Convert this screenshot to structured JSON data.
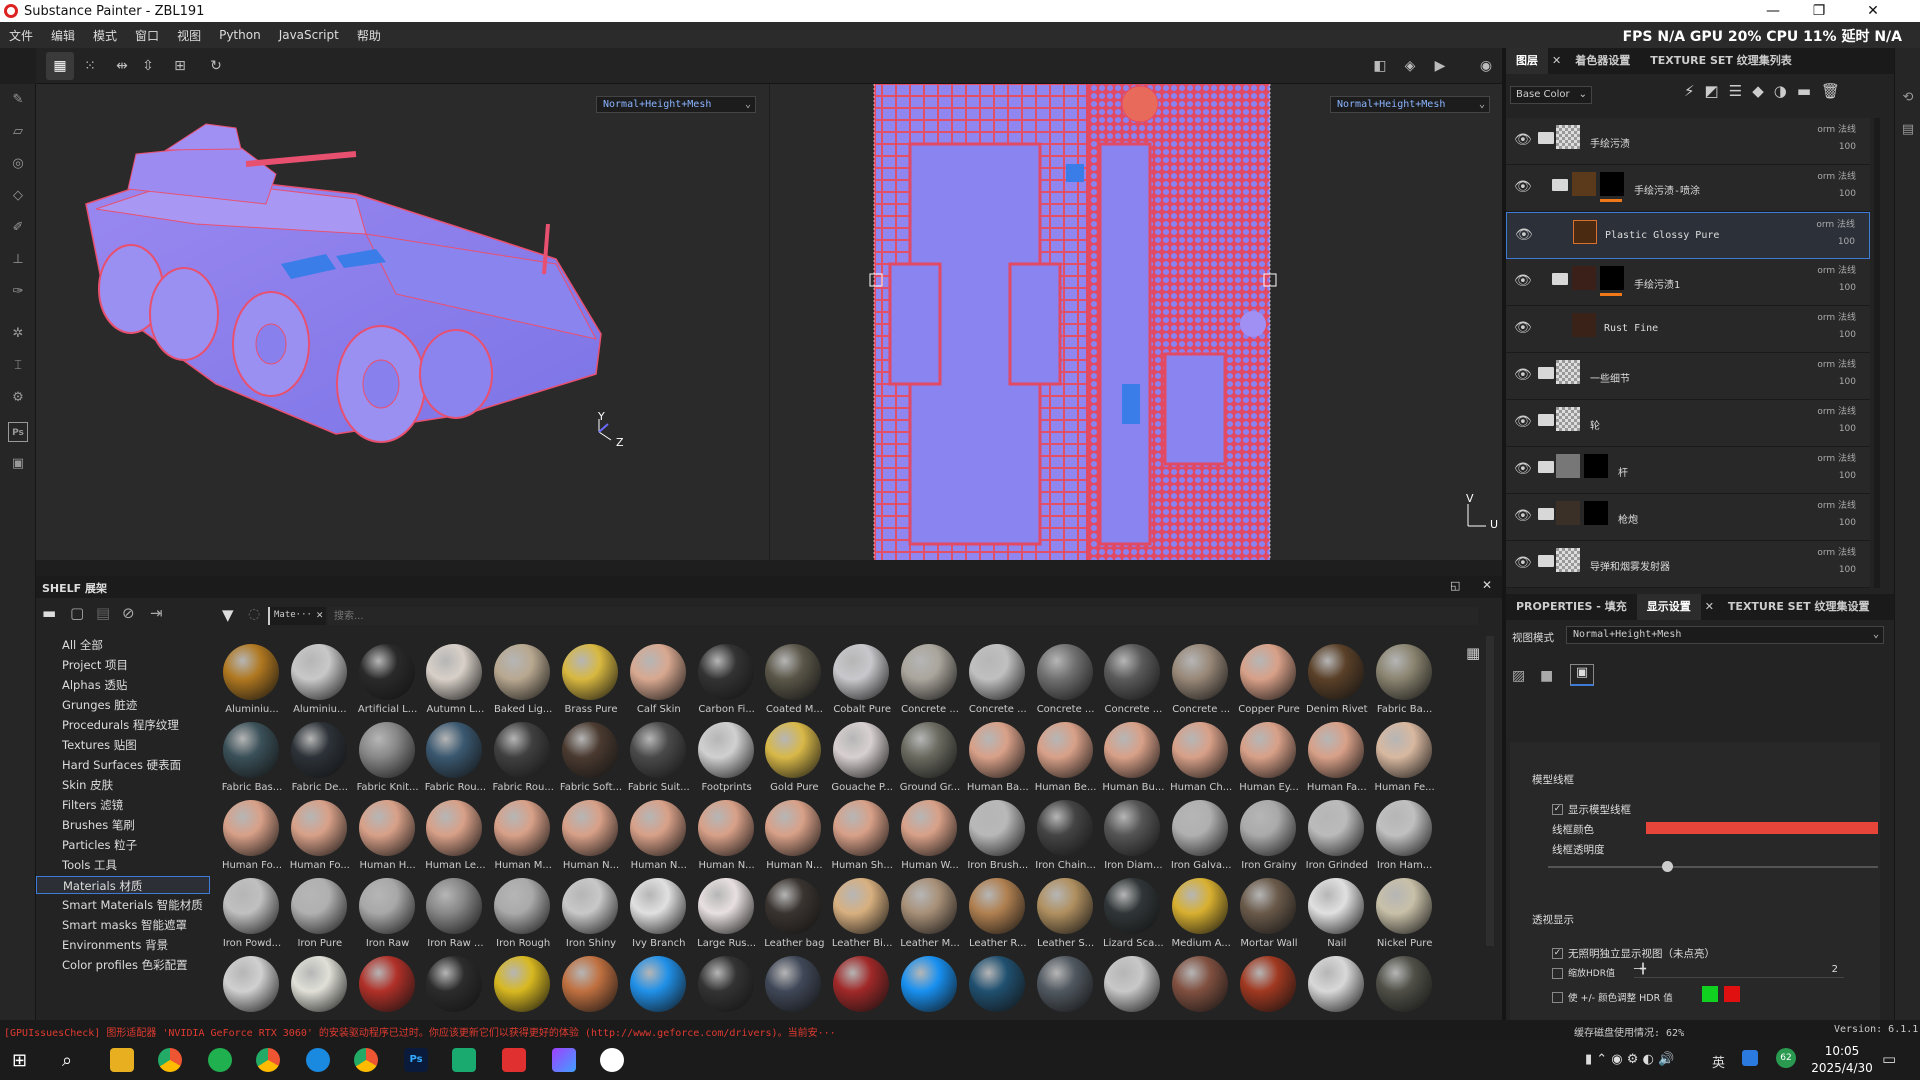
{
  "window": {
    "title": "Substance Painter - ZBL191",
    "minimize": "—",
    "restore": "❐",
    "close": "✕"
  },
  "menu": [
    "文件",
    "编辑",
    "模式",
    "窗口",
    "视图",
    "Python",
    "JavaScript",
    "帮助"
  ],
  "stats": "FPS N/A GPU 20% CPU 11% 延时 N/A",
  "viewport": {
    "mode_3d": "Normal+Height+Mesh",
    "mode_2d": "Normal+Height+Mesh",
    "axis_3d": {
      "y": "Y",
      "z": "Z"
    },
    "axis_2d": {
      "v": "V",
      "u": "U"
    }
  },
  "layers_panel": {
    "tabs": [
      "图层",
      "着色器设置",
      "TEXTURE SET 纹理集列表"
    ],
    "channel": "Base Color",
    "layers": [
      {
        "name": "手绘污渍",
        "blend": "orm 法线",
        "opacity": "100",
        "type": "folder"
      },
      {
        "name": "手绘污渍-喷涂",
        "blend": "orm 法线",
        "opacity": "100",
        "type": "folder-mask"
      },
      {
        "name": "Plastic Glossy Pure",
        "blend": "orm 法线",
        "opacity": "100",
        "type": "fill",
        "selected": true
      },
      {
        "name": "手绘污渍1",
        "blend": "orm 法线",
        "opacity": "100",
        "type": "folder-mask"
      },
      {
        "name": "Rust Fine",
        "blend": "orm 法线",
        "opacity": "100",
        "type": "fill"
      },
      {
        "name": "一些细节",
        "blend": "orm 法线",
        "opacity": "100",
        "type": "folder"
      },
      {
        "name": "轮",
        "blend": "orm 法线",
        "opacity": "100",
        "type": "folder"
      },
      {
        "name": "杆",
        "blend": "orm 法线",
        "opacity": "100",
        "type": "folder-mask"
      },
      {
        "name": "枪炮",
        "blend": "orm 法线",
        "opacity": "100",
        "type": "folder-mask"
      },
      {
        "name": "导弹和烟雾发射器",
        "blend": "orm 法线",
        "opacity": "100",
        "type": "folder"
      }
    ]
  },
  "props_panel": {
    "tabs": [
      "PROPERTIES - 填充",
      "显示设置",
      "TEXTURE SET 纹理集设置"
    ],
    "view_mode_label": "视图模式",
    "view_mode_value": "Normal+Height+Mesh",
    "section_wire": "模型线框",
    "show_wire": "显示模型线框",
    "wire_color": "线框颜色",
    "wire_opacity": "线框透明度",
    "wire_opacity_value": 0.36,
    "wire_color_hex": "#e8453a",
    "section_transp": "透视显示",
    "transp_opt1": "无照明独立显示视图（未点亮）",
    "transp_opt2": "缩放HDR值",
    "transp_opt2_value": "2",
    "transp_opt3": "使 +/- 颜色调整 HDR 值"
  },
  "shelf": {
    "title": "SHELF 展架",
    "filter_tag": "Mate···",
    "search_placeholder": "搜索...",
    "categories": [
      "All 全部",
      "Project 项目",
      "Alphas 透贴",
      "Grunges 脏迹",
      "Procedurals 程序纹理",
      "Textures 贴图",
      "Hard Surfaces 硬表面",
      "Skin 皮肤",
      "Filters 滤镜",
      "Brushes 笔刷",
      "Particles 粒子",
      "Tools 工具",
      "Materials 材质",
      "Smart Materials 智能材质",
      "Smart masks 智能遮罩",
      "Environments 背景",
      "Color profiles 色彩配置"
    ],
    "selected_category": "Materials 材质",
    "materials": [
      [
        "Aluminiu...",
        "#b07820"
      ],
      [
        "Aluminiu...",
        "#c8c8c8"
      ],
      [
        "Artificial L...",
        "#2a2a2a"
      ],
      [
        "Autumn L...",
        "#d8d0c8"
      ],
      [
        "Baked Lig...",
        "#b8a890"
      ],
      [
        "Brass Pure",
        "#d8b840"
      ],
      [
        "Calf Skin",
        "#d8a890"
      ],
      [
        "Carbon Fi...",
        "#333"
      ],
      [
        "Coated M...",
        "#5a5648"
      ],
      [
        "Cobalt Pure",
        "#c8c8cc"
      ],
      [
        "Concrete ...",
        "#aaa59c"
      ],
      [
        "Concrete ...",
        "#c0c0c0"
      ],
      [
        "Concrete ...",
        "#707070"
      ],
      [
        "Concrete ...",
        "#5a5a5a"
      ],
      [
        "Concrete ...",
        "#988878"
      ],
      [
        "Copper Pure",
        "#d8a088"
      ],
      [
        "Denim Rivet",
        "#5a4028"
      ],
      [
        "Fabric Ba...",
        "#8a8470"
      ],
      [
        "Fabric Bas...",
        "#3a5058"
      ],
      [
        "Fabric De...",
        "#2c3238"
      ],
      [
        "Fabric Knit...",
        "#888888"
      ],
      [
        "Fabric Rou...",
        "#3a5870"
      ],
      [
        "Fabric Rou...",
        "#404040"
      ],
      [
        "Fabric Soft...",
        "#4a3a30"
      ],
      [
        "Fabric Suit...",
        "#4a4a4a"
      ],
      [
        "Footprints",
        "#d0d0d0"
      ],
      [
        "Gold Pure",
        "#d8b848"
      ],
      [
        "Gouache P...",
        "#d8d0d0"
      ],
      [
        "Ground Gr...",
        "#6a6a60"
      ],
      [
        "Human Ba...",
        "#d8a088"
      ],
      [
        "Human Be...",
        "#d8a088"
      ],
      [
        "Human Bu...",
        "#d8a088"
      ],
      [
        "Human Ch...",
        "#d8a088"
      ],
      [
        "Human Ey...",
        "#d8a088"
      ],
      [
        "Human Fa...",
        "#d8a088"
      ],
      [
        "Human Fe...",
        "#d8b8a0"
      ],
      [
        "Human Fo...",
        "#d8a088"
      ],
      [
        "Human Fo...",
        "#d8a088"
      ],
      [
        "Human H...",
        "#d8a088"
      ],
      [
        "Human Le...",
        "#d8a088"
      ],
      [
        "Human M...",
        "#d8a088"
      ],
      [
        "Human N...",
        "#d8a088"
      ],
      [
        "Human N...",
        "#d8a088"
      ],
      [
        "Human N...",
        "#d8a088"
      ],
      [
        "Human N...",
        "#d8a088"
      ],
      [
        "Human Sh...",
        "#d8a088"
      ],
      [
        "Human W...",
        "#d8a088"
      ],
      [
        "Iron Brush...",
        "#b8b8b8"
      ],
      [
        "Iron Chain...",
        "#444"
      ],
      [
        "Iron Diam...",
        "#555"
      ],
      [
        "Iron Galva...",
        "#b0b0b0"
      ],
      [
        "Iron Grainy",
        "#aaaaaa"
      ],
      [
        "Iron Grinded",
        "#bbbbbb"
      ],
      [
        "Iron Ham...",
        "#c0c0c0"
      ],
      [
        "Iron Powd...",
        "#c0c0c0"
      ],
      [
        "Iron Pure",
        "#b0b0b0"
      ],
      [
        "Iron Raw",
        "#a8a8a8"
      ],
      [
        "Iron Raw ...",
        "#888"
      ],
      [
        "Iron Rough",
        "#aaaaaa"
      ],
      [
        "Iron Shiny",
        "#c8c8c8"
      ],
      [
        "Ivy Branch",
        "#e0e0e0"
      ],
      [
        "Large Rus...",
        "#e8e0e0"
      ],
      [
        "Leather bag",
        "#3a3430"
      ],
      [
        "Leather Bi...",
        "#d8b080"
      ],
      [
        "Leather M...",
        "#a89078"
      ],
      [
        "Leather R...",
        "#b08050"
      ],
      [
        "Leather S...",
        "#b09060"
      ],
      [
        "Lizard Sca...",
        "#303638"
      ],
      [
        "Medium A...",
        "#d8b030"
      ],
      [
        "Mortar Wall",
        "#6a5a4a"
      ],
      [
        "Nail",
        "#e0e0e0"
      ],
      [
        "Nickel Pure",
        "#c8c0a8"
      ],
      [
        "",
        "#d0d0d0"
      ],
      [
        "",
        "#e0e0d8"
      ],
      [
        "",
        "#b03028"
      ],
      [
        "",
        "#2c2c2c"
      ],
      [
        "",
        "#d8b820"
      ],
      [
        "",
        "#c07040"
      ],
      [
        "",
        "#2090e8"
      ],
      [
        "",
        "#333"
      ],
      [
        "",
        "#404858"
      ],
      [
        "",
        "#a02828"
      ],
      [
        "",
        "#1890f0"
      ],
      [
        "",
        "#205070"
      ],
      [
        "",
        "#505860"
      ],
      [
        "",
        "#c8c8c8"
      ],
      [
        "",
        "#805040"
      ],
      [
        "",
        "#a03820"
      ],
      [
        "",
        "#d8d8d8"
      ],
      [
        "",
        "#505048"
      ]
    ]
  },
  "statusbar": {
    "message": "[GPUIssuesCheck] 图形适配器 'NVIDIA GeForce RTX 3060' 的安装驱动程序已过时。你应该更新它们以获得更好的体验 (http://www.geforce.com/drivers)。当前安···",
    "cache": "缓存磁盘使用情况:   62%",
    "version": "Version: 6.1.1"
  },
  "taskbar": {
    "ime": "英",
    "time": "10:05",
    "date": "2025/4/30",
    "notif": "62"
  }
}
